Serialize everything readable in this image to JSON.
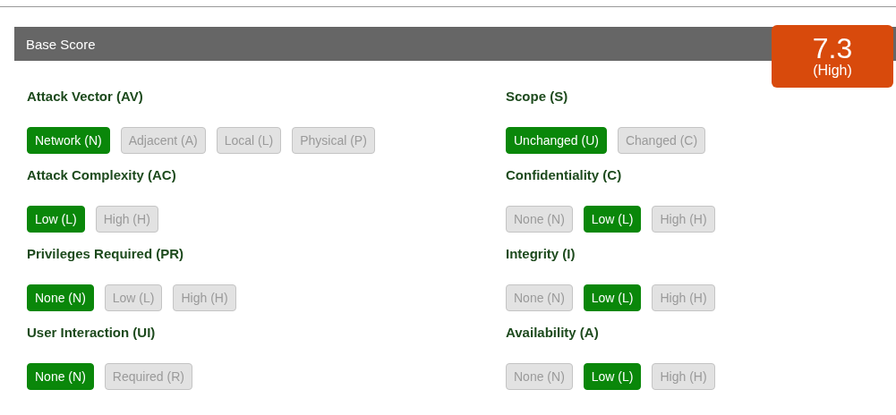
{
  "section": {
    "title": "Base Score"
  },
  "score": {
    "value": "7.3",
    "rating": "(High)"
  },
  "columns": [
    [
      {
        "name": "Attack Vector (AV)",
        "options": [
          {
            "label": "Network (N)",
            "selected": true
          },
          {
            "label": "Adjacent (A)",
            "selected": false
          },
          {
            "label": "Local (L)",
            "selected": false
          },
          {
            "label": "Physical (P)",
            "selected": false
          }
        ]
      },
      {
        "name": "Attack Complexity (AC)",
        "options": [
          {
            "label": "Low (L)",
            "selected": true
          },
          {
            "label": "High (H)",
            "selected": false
          }
        ]
      },
      {
        "name": "Privileges Required (PR)",
        "options": [
          {
            "label": "None (N)",
            "selected": true
          },
          {
            "label": "Low (L)",
            "selected": false
          },
          {
            "label": "High (H)",
            "selected": false
          }
        ]
      },
      {
        "name": "User Interaction (UI)",
        "options": [
          {
            "label": "None (N)",
            "selected": true
          },
          {
            "label": "Required (R)",
            "selected": false
          }
        ]
      }
    ],
    [
      {
        "name": "Scope (S)",
        "options": [
          {
            "label": "Unchanged (U)",
            "selected": true
          },
          {
            "label": "Changed (C)",
            "selected": false
          }
        ]
      },
      {
        "name": "Confidentiality (C)",
        "options": [
          {
            "label": "None (N)",
            "selected": false
          },
          {
            "label": "Low (L)",
            "selected": true
          },
          {
            "label": "High (H)",
            "selected": false
          }
        ]
      },
      {
        "name": "Integrity (I)",
        "options": [
          {
            "label": "None (N)",
            "selected": false
          },
          {
            "label": "Low (L)",
            "selected": true
          },
          {
            "label": "High (H)",
            "selected": false
          }
        ]
      },
      {
        "name": "Availability (A)",
        "options": [
          {
            "label": "None (N)",
            "selected": false
          },
          {
            "label": "Low (L)",
            "selected": true
          },
          {
            "label": "High (H)",
            "selected": false
          }
        ]
      }
    ]
  ]
}
